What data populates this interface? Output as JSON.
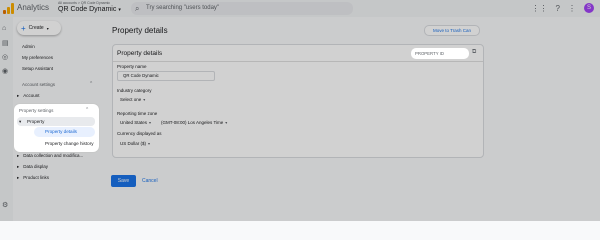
{
  "topbar": {
    "app_title": "Analytics",
    "account_path": "All accounts > QR Code Dynamic",
    "property_name": "QR Code Dynamic",
    "search_placeholder": "Try searching \"users today\"",
    "avatar_letter": "S"
  },
  "sidebar": {
    "create_label": "Create",
    "admin": "Admin",
    "preferences": "My preferences",
    "setup_assistant": "Setup Assistant",
    "account_settings": "Account settings",
    "account": "Account",
    "property_settings": "Property settings",
    "property": "Property",
    "property_details": "Property details",
    "property_change_history": "Property change history",
    "data_collection": "Data collection and modifica...",
    "data_display": "Data display",
    "product_links": "Product links"
  },
  "main": {
    "page_title": "Property details",
    "move_to_trash": "Move to Trash Can",
    "card_title": "Property details",
    "property_id_label": "PROPERTY ID",
    "property_name_label": "Property name",
    "property_name_value": "QR Code Dynamic",
    "industry_label": "Industry category",
    "industry_value": "Select one",
    "timezone_label": "Reporting time zone",
    "timezone_country": "United States",
    "timezone_value": "(GMT-08:00) Los Angeles Time",
    "currency_label": "Currency displayed as",
    "currency_value": "US Dollar ($)",
    "save": "Save",
    "cancel": "Cancel"
  },
  "colors": {
    "accent": "#1a73e8",
    "avatar": "#a142f4",
    "logo_orange": "#f9ab00",
    "logo_dark_orange": "#e37400"
  }
}
